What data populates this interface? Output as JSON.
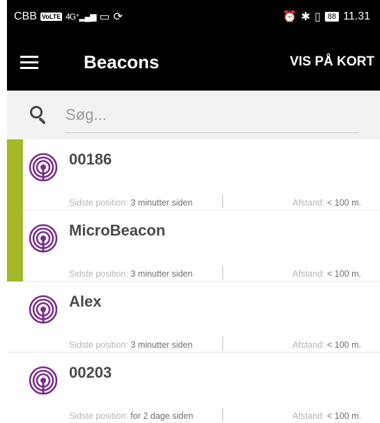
{
  "status_bar": {
    "carrier": "CBB",
    "volte": "VoLTE",
    "network": "4G⁺",
    "battery": "88",
    "time": "11.31"
  },
  "app_bar": {
    "title": "Beacons",
    "map_action": "VIS PÅ KORT",
    "menu_icon": "hamburger-menu-icon"
  },
  "search": {
    "placeholder": "Søg...",
    "value": "",
    "icon": "search-icon"
  },
  "colors": {
    "accent_bar": "#a4b82a",
    "beacon_icon": "#7a2b8c"
  },
  "labels": {
    "last_position": "Sidste position:",
    "distance": "Afstand:"
  },
  "beacons": [
    {
      "name": "00186",
      "last_position": "3 minutter siden",
      "distance": "< 100 m.",
      "highlighted": true
    },
    {
      "name": "MicroBeacon",
      "last_position": "3 minutter siden",
      "distance": "< 100 m.",
      "highlighted": true
    },
    {
      "name": "Alex",
      "last_position": "3 minutter siden",
      "distance": "< 100 m.",
      "highlighted": false
    },
    {
      "name": "00203",
      "last_position": "for 2 dage siden",
      "distance": "< 100 m.",
      "highlighted": false
    }
  ]
}
